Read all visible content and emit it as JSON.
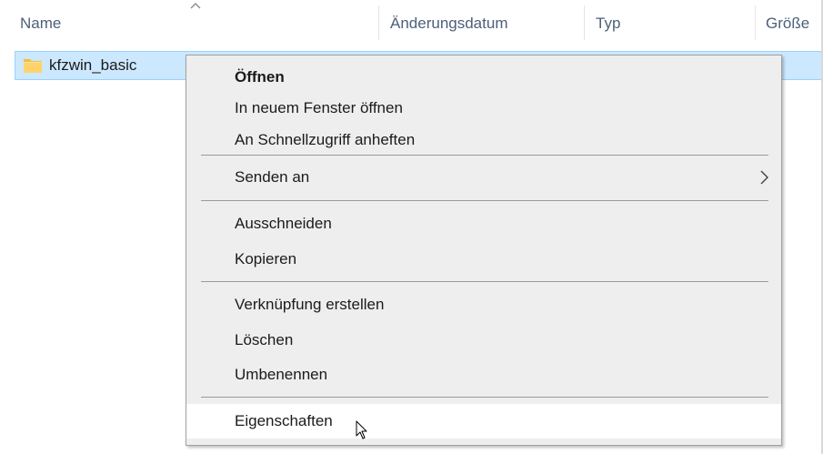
{
  "columns": {
    "name": "Name",
    "modified": "Änderungsdatum",
    "type": "Typ",
    "size": "Größe"
  },
  "file": {
    "name": "kfzwin_basic",
    "icon": "folder-icon"
  },
  "context_menu": {
    "open": "Öffnen",
    "open_new_window": "In neuem Fenster öffnen",
    "pin_quick_access": "An Schnellzugriff anheften",
    "send_to": "Senden an",
    "cut": "Ausschneiden",
    "copy": "Kopieren",
    "create_shortcut": "Verknüpfung erstellen",
    "delete": "Löschen",
    "rename": "Umbenennen",
    "properties": "Eigenschaften"
  },
  "colors": {
    "selection": "#cce8ff",
    "selection_border": "#99d1ff",
    "menu_background": "#eeeeee",
    "menu_hover": "#ffffff",
    "header_text": "#4c607a",
    "folder": "#ffd36b"
  }
}
